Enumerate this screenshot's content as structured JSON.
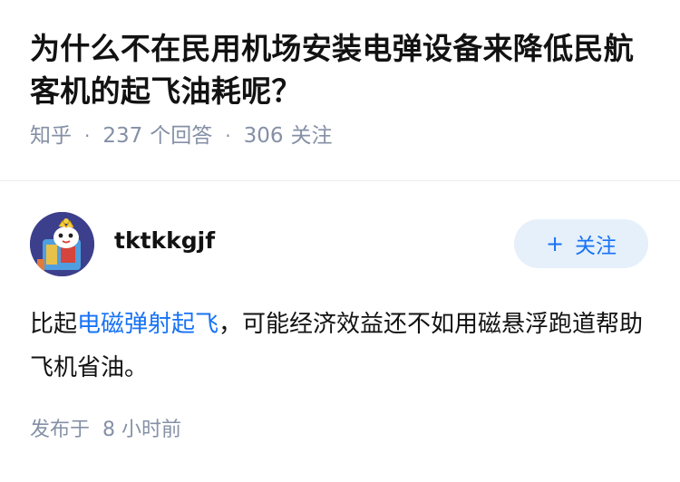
{
  "question": {
    "title": "为什么不在民用机场安装电弹设备来降低民航客机的起飞油耗呢？",
    "source": "知乎",
    "answer_count": "237",
    "answer_label": "个回答",
    "follow_count": "306",
    "follow_label": "关注"
  },
  "answer": {
    "author": "tktkkgjf",
    "follow_button_plus": "+",
    "follow_button_label": "关注",
    "body_prefix": "比起",
    "body_link": "电磁弹射起飞",
    "body_suffix": "，可能经济效益还不如用磁悬浮跑道帮助飞机省油。",
    "published_label": "发布于",
    "published_time": "8 小时前"
  },
  "colors": {
    "accent": "#1772f6",
    "meta_gray": "#8590a6",
    "follow_bg": "#e6f0fb",
    "avatar_bg": "#3c3f8c"
  }
}
